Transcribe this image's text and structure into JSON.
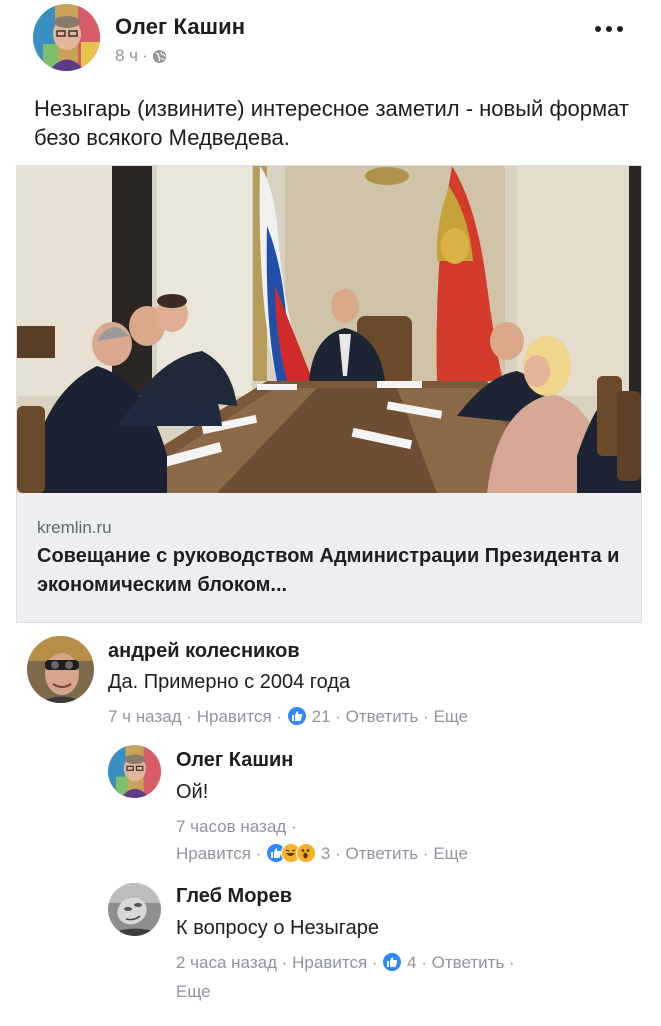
{
  "post": {
    "author": "Олег Кашин",
    "time": "8 ч",
    "meta_separator": "·",
    "privacy_icon": "globe-icon",
    "more_icon": "more-options-icon",
    "text": "Незыгарь (извините) интересное заметил - новый формат безо всякого Медведева."
  },
  "link_preview": {
    "domain": "kremlin.ru",
    "title": "Совещание с руководством Администрации Президента и экономическим блоком..."
  },
  "comments": [
    {
      "author": "андрей колесников",
      "text": "Да. Примерно с 2004 года",
      "time": "7 ч назад",
      "like_label": "Нравится",
      "reaction_count": "21",
      "reactions": [
        "like-icon"
      ],
      "reply_label": "Ответить",
      "more_label": "Еще",
      "sep": "·"
    }
  ],
  "replies": [
    {
      "author": "Олег Кашин",
      "text": "Ой!",
      "time": "7 часов назад",
      "like_label": "Нравится",
      "reaction_count": "3",
      "reactions": [
        "like-icon",
        "haha-icon",
        "wow-icon"
      ],
      "reply_label": "Ответить",
      "more_label": "Еще",
      "sep": "·"
    },
    {
      "author": "Глеб Морев",
      "text": "К вопросу о Незыгаре",
      "time": "2 часа назад",
      "like_label": "Нравится",
      "reaction_count": "4",
      "reactions": [
        "like-icon"
      ],
      "reply_label": "Ответить",
      "more_label": "Еще",
      "sep": "·"
    }
  ],
  "colors": {
    "text": "#1c1e21",
    "meta": "#90949c",
    "like_blue": "#2d88ff",
    "card_bg": "#eceef1"
  }
}
